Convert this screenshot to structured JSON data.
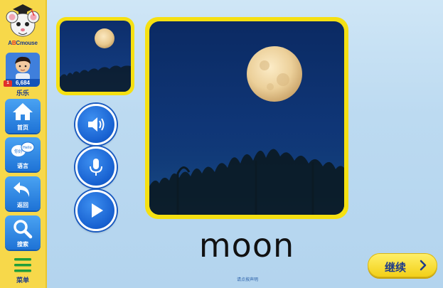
{
  "brand": {
    "logo_text_pre": "A",
    "logo_text_red": "B",
    "logo_text_post": "Cmouse"
  },
  "profile": {
    "points": "6,684",
    "badge": "1",
    "name": "乐乐"
  },
  "nav": {
    "home": "首页",
    "language": "语言",
    "language_bubble_1": "你好",
    "language_bubble_2": "Hello",
    "back": "返回",
    "search": "搜索",
    "menu": "菜单"
  },
  "card": {
    "word": "moon",
    "footnote": "请点按声明"
  },
  "actions": {
    "continue": "继续"
  },
  "colors": {
    "frame": "#f5e012",
    "sidebar": "#f7d84a",
    "button_blue": "#1760d0"
  },
  "icons": [
    "speaker-icon",
    "microphone-icon",
    "play-icon",
    "home-icon",
    "chat-bubbles-icon",
    "back-arrow-icon",
    "magnifier-icon",
    "hamburger-icon",
    "chevron-right-icon"
  ]
}
